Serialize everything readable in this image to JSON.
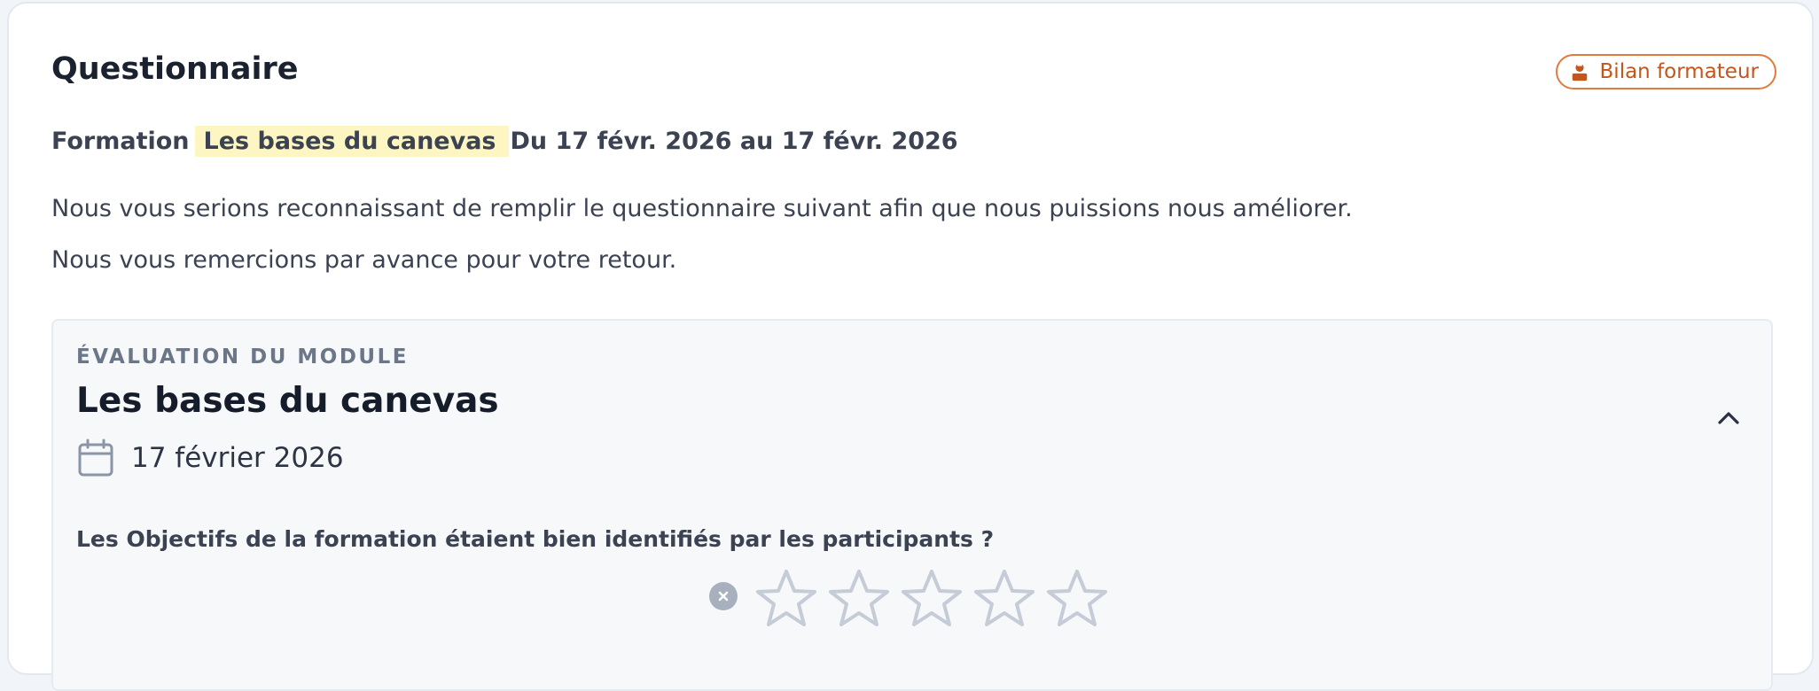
{
  "header": {
    "title": "Questionnaire",
    "badge_label": "Bilan formateur",
    "badge_icon": "trainer-icon",
    "accent_color": "#e07b3d"
  },
  "formation": {
    "label": "Formation",
    "name": "Les bases du canevas",
    "dates": "Du 17 févr. 2026 au 17 févr. 2026"
  },
  "intro": {
    "line1": "Nous vous serions reconnaissant de remplir le questionnaire suivant afin que nous puissions nous améliorer.",
    "line2": "Nous vous remercions par avance pour votre retour."
  },
  "module": {
    "eyebrow": "ÉVALUATION DU MODULE",
    "title": "Les bases du canevas",
    "date": "17 février 2026",
    "date_icon": "calendar-icon",
    "collapse_icon": "chevron-up-icon",
    "question": "Les Objectifs de la formation étaient bien identifiés par les participants ?",
    "rating": {
      "value": 0,
      "max": 5,
      "clear_icon": "clear-icon",
      "star_icon": "star-icon"
    }
  }
}
